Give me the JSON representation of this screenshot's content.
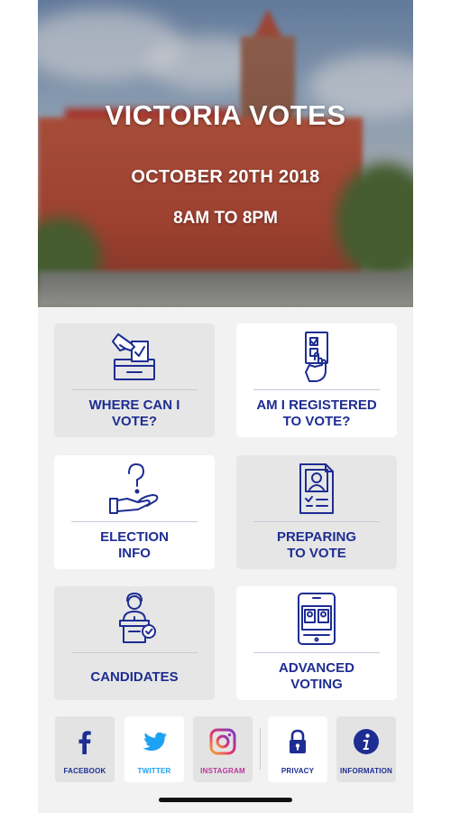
{
  "hero": {
    "title": "VICTORIA VOTES",
    "date": "OCTOBER 20TH 2018",
    "hours": "8AM TO 8PM"
  },
  "tiles": [
    {
      "label": "WHERE CAN I\nVOTE?",
      "icon": "ballot-box-icon"
    },
    {
      "label": "AM I REGISTERED\nTO VOTE?",
      "icon": "hand-card-check-icon"
    },
    {
      "label": "ELECTION\nINFO",
      "icon": "hand-question-icon"
    },
    {
      "label": "PREPARING\nTO VOTE",
      "icon": "document-candidate-icon"
    },
    {
      "label": "CANDIDATES",
      "icon": "speaker-podium-icon"
    },
    {
      "label": "ADVANCED\nVOTING",
      "icon": "phone-ballot-icon"
    }
  ],
  "social": [
    {
      "label": "FACEBOOK",
      "icon": "facebook-icon",
      "color": "#1e2d92"
    },
    {
      "label": "TWITTER",
      "icon": "twitter-icon",
      "color": "#1da1f2"
    },
    {
      "label": "INSTAGRAM",
      "icon": "instagram-icon",
      "color": "#b7369a"
    },
    {
      "label": "PRIVACY",
      "icon": "lock-icon",
      "color": "#1e2d92"
    },
    {
      "label": "INFORMATION",
      "icon": "info-icon",
      "color": "#1e2d92"
    }
  ],
  "colors": {
    "accent": "#1e2d92",
    "tile_gray": "#e6e6e6",
    "background": "#f2f2f2"
  }
}
